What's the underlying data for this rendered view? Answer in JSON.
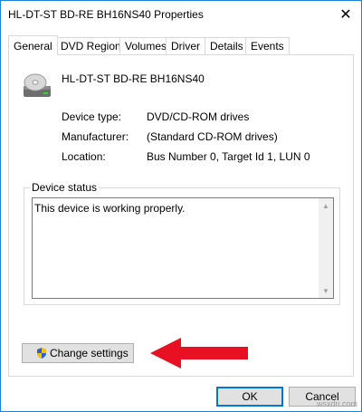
{
  "window": {
    "title": "HL-DT-ST BD-RE  BH16NS40 Properties",
    "close_icon": "close-icon"
  },
  "tabs": [
    {
      "label": "General",
      "active": true
    },
    {
      "label": "DVD Region",
      "active": false
    },
    {
      "label": "Volumes",
      "active": false
    },
    {
      "label": "Driver",
      "active": false
    },
    {
      "label": "Details",
      "active": false
    },
    {
      "label": "Events",
      "active": false
    }
  ],
  "device": {
    "icon": "optical-drive-icon",
    "name": "HL-DT-ST BD-RE  BH16NS40"
  },
  "properties": [
    {
      "label": "Device type:",
      "value": "DVD/CD-ROM drives"
    },
    {
      "label": "Manufacturer:",
      "value": "(Standard CD-ROM drives)"
    },
    {
      "label": "Location:",
      "value": "Bus Number 0, Target Id 1, LUN 0"
    }
  ],
  "status": {
    "group_label": "Device status",
    "text": "This device is working properly."
  },
  "buttons": {
    "change_settings": "Change settings",
    "ok": "OK",
    "cancel": "Cancel"
  },
  "annotation": {
    "arrow_color": "#e81123"
  },
  "watermark": "wsxdn.com"
}
